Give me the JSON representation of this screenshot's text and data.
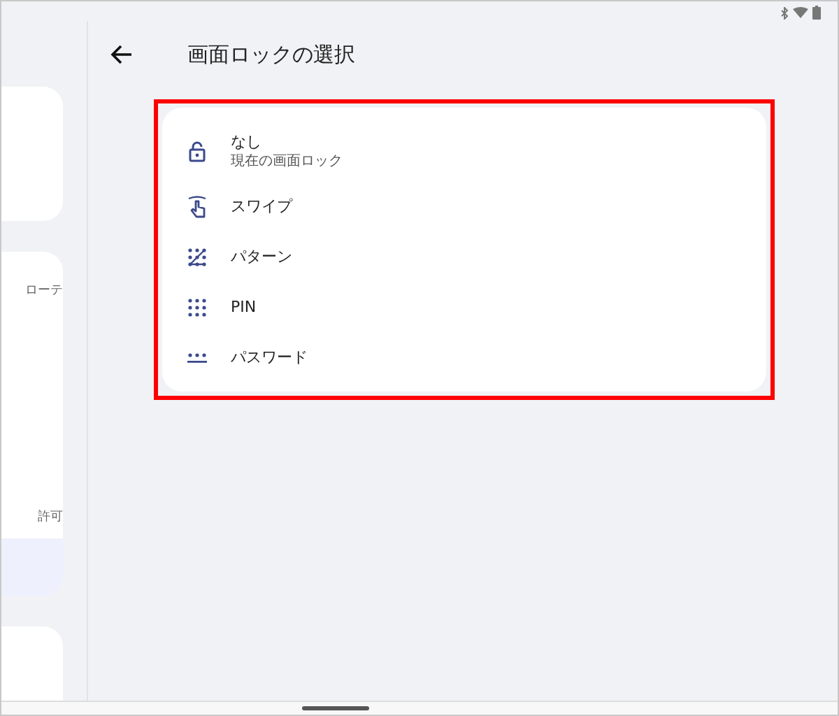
{
  "left_panel": {
    "items": [
      {
        "label": "ローテ",
        "selected": false
      },
      {
        "label": "許可",
        "selected": false
      },
      {
        "selected": true
      }
    ]
  },
  "header": {
    "title": "画面ロックの選択"
  },
  "lock_options": [
    {
      "kind": "none",
      "label": "なし",
      "subtitle": "現在の画面ロック"
    },
    {
      "kind": "swipe",
      "label": "スワイプ"
    },
    {
      "kind": "pattern",
      "label": "パターン"
    },
    {
      "kind": "pin",
      "label": "PIN"
    },
    {
      "kind": "password",
      "label": "パスワード"
    }
  ]
}
